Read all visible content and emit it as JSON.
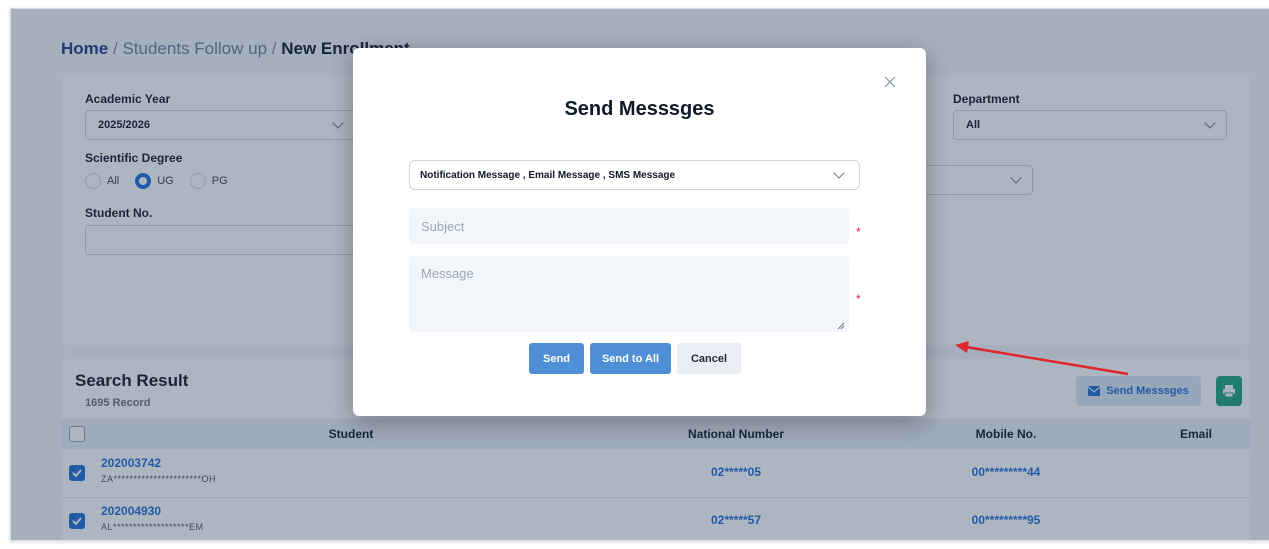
{
  "breadcrumb": {
    "home": "Home",
    "separator": "/",
    "middle": "Students Follow up",
    "current": "New Enrollment"
  },
  "filters": {
    "academic_year": {
      "label": "Academic Year",
      "value": "2025/2026"
    },
    "department": {
      "label": "Department",
      "value": "All"
    },
    "scientific_degree": {
      "label": "Scientific Degree",
      "options": [
        {
          "label": "All",
          "selected": false
        },
        {
          "label": "UG",
          "selected": true
        },
        {
          "label": "PG",
          "selected": false
        }
      ]
    },
    "student_no": {
      "label": "Student No."
    }
  },
  "results": {
    "title": "Search Result",
    "count": "1695 Record",
    "send_button": "Send Messsges",
    "columns": [
      "Student",
      "National Number",
      "Mobile No.",
      "Email"
    ],
    "rows": [
      {
        "checked": true,
        "id": "202003742",
        "name": "ZA**********************OH",
        "national": "02*****05",
        "mobile": "00*********44",
        "email": ""
      },
      {
        "checked": true,
        "id": "202004930",
        "name": "AL*******************EM",
        "national": "02*****57",
        "mobile": "00*********95",
        "email": ""
      }
    ]
  },
  "modal": {
    "title": "Send Messsges",
    "message_types": "Notification Message , Email Message , SMS Message",
    "subject_placeholder": "Subject",
    "message_placeholder": "Message",
    "required_mark": "*",
    "send": "Send",
    "send_all": "Send to All",
    "cancel": "Cancel"
  },
  "colors": {
    "accent": "#1d6fd6",
    "primary_button": "#4f8fd6",
    "annotation_arrow": "#e0262b",
    "print_button": "#1fa37a"
  }
}
